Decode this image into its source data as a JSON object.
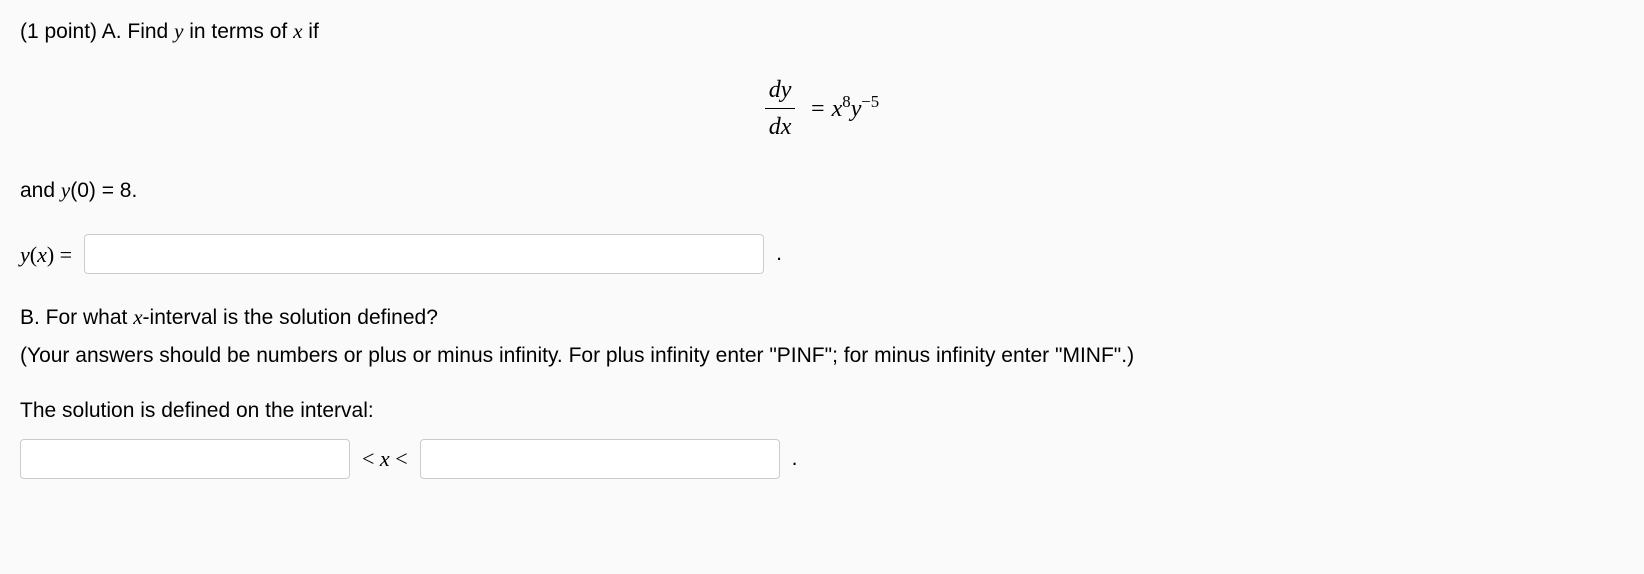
{
  "problem": {
    "points_prefix": "(1 point) A. Find ",
    "var_y": "y",
    "prompt_mid": " in terms of ",
    "var_x": "x",
    "prompt_suffix": " if",
    "equation": {
      "frac_num": "dy",
      "frac_den": "dx",
      "equals": " = ",
      "rhs_prefix": "x",
      "rhs_exp1": "8",
      "rhs_mid": "y",
      "rhs_exp2": "−5"
    },
    "condition_prefix": "and ",
    "condition_y": "y",
    "condition_paren": "(0) = 8.",
    "answer_label_y": "y",
    "answer_label_paren": "(",
    "answer_label_x": "x",
    "answer_label_close": ") =",
    "period": "."
  },
  "partB": {
    "title_prefix": "B. For what ",
    "title_var": "x",
    "title_suffix": "-interval is the solution defined?",
    "note": "(Your answers should be numbers or plus or minus infinity. For plus infinity enter \"PINF\"; for minus infinity enter \"MINF\".)",
    "interval_label": "The solution is defined on the interval:",
    "lt1_open": "< ",
    "lt_var": "x",
    "lt1_close": " <",
    "period": "."
  }
}
